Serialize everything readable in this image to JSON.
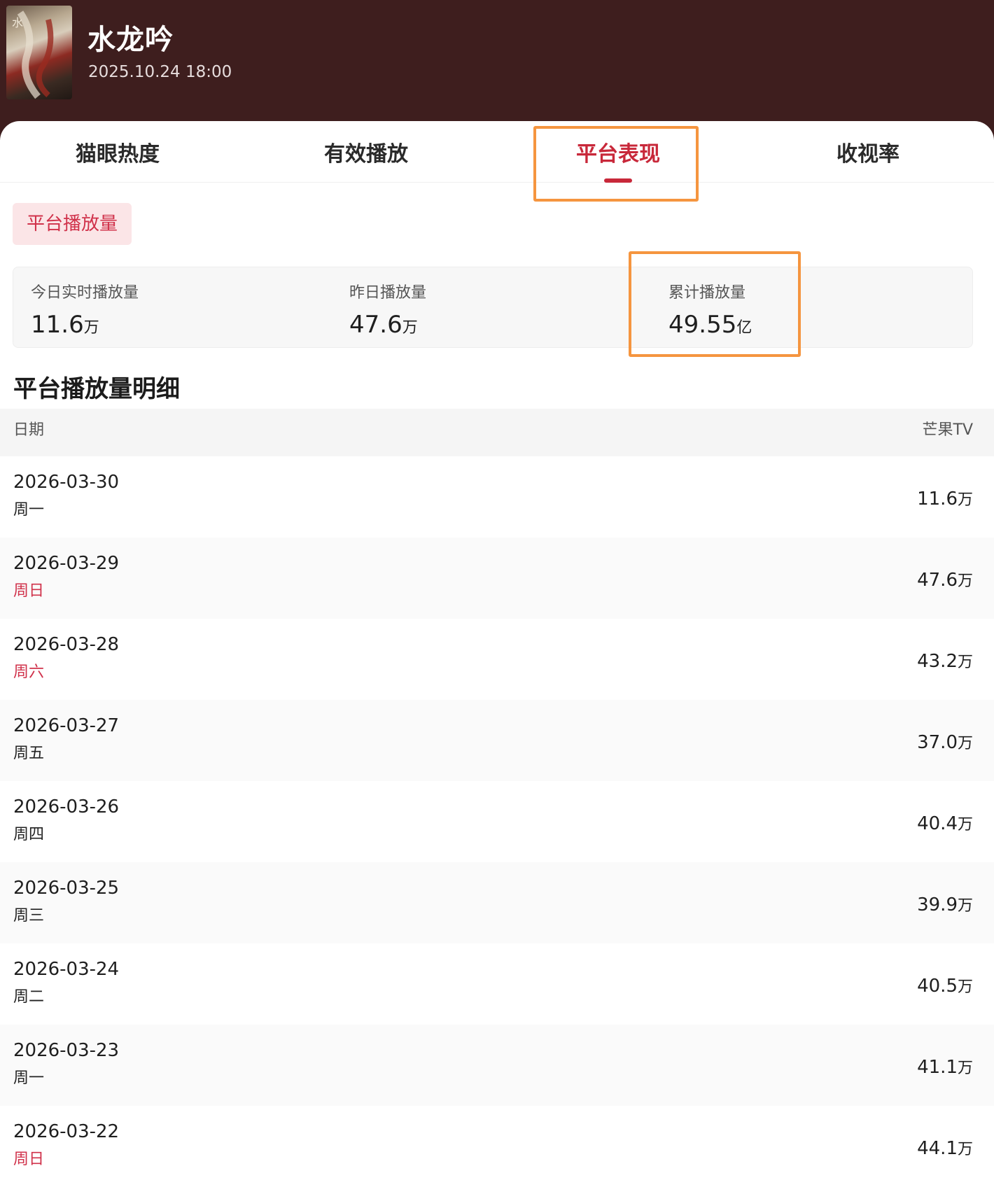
{
  "header": {
    "title": "水龙吟",
    "datetime": "2025.10.24 18:00",
    "poster_icon": "poster-image"
  },
  "tabs": [
    {
      "label": "猫眼热度",
      "active": false
    },
    {
      "label": "有效播放",
      "active": false
    },
    {
      "label": "平台表现",
      "active": true
    },
    {
      "label": "收视率",
      "active": false
    }
  ],
  "section_pill": "平台播放量",
  "stats": [
    {
      "label": "今日实时播放量",
      "value": "11.6",
      "unit": "万"
    },
    {
      "label": "昨日播放量",
      "value": "47.6",
      "unit": "万"
    },
    {
      "label": "累计播放量",
      "value": "49.55",
      "unit": "亿"
    }
  ],
  "detail": {
    "title": "平台播放量明细",
    "col_date": "日期",
    "col_platform": "芒果TV",
    "rows": [
      {
        "date": "2026-03-30",
        "weekday": "周一",
        "weekend": false,
        "value": "11.6",
        "unit": "万"
      },
      {
        "date": "2026-03-29",
        "weekday": "周日",
        "weekend": true,
        "value": "47.6",
        "unit": "万"
      },
      {
        "date": "2026-03-28",
        "weekday": "周六",
        "weekend": true,
        "value": "43.2",
        "unit": "万"
      },
      {
        "date": "2026-03-27",
        "weekday": "周五",
        "weekend": false,
        "value": "37.0",
        "unit": "万"
      },
      {
        "date": "2026-03-26",
        "weekday": "周四",
        "weekend": false,
        "value": "40.4",
        "unit": "万"
      },
      {
        "date": "2026-03-25",
        "weekday": "周三",
        "weekend": false,
        "value": "39.9",
        "unit": "万"
      },
      {
        "date": "2026-03-24",
        "weekday": "周二",
        "weekend": false,
        "value": "40.5",
        "unit": "万"
      },
      {
        "date": "2026-03-23",
        "weekday": "周一",
        "weekend": false,
        "value": "41.1",
        "unit": "万"
      },
      {
        "date": "2026-03-22",
        "weekday": "周日",
        "weekend": true,
        "value": "44.1",
        "unit": "万"
      }
    ]
  },
  "colors": {
    "header_bg": "#3e1e1e",
    "accent": "#c8283a",
    "highlight": "#f5953f",
    "pill_bg": "#fbe5e7"
  }
}
